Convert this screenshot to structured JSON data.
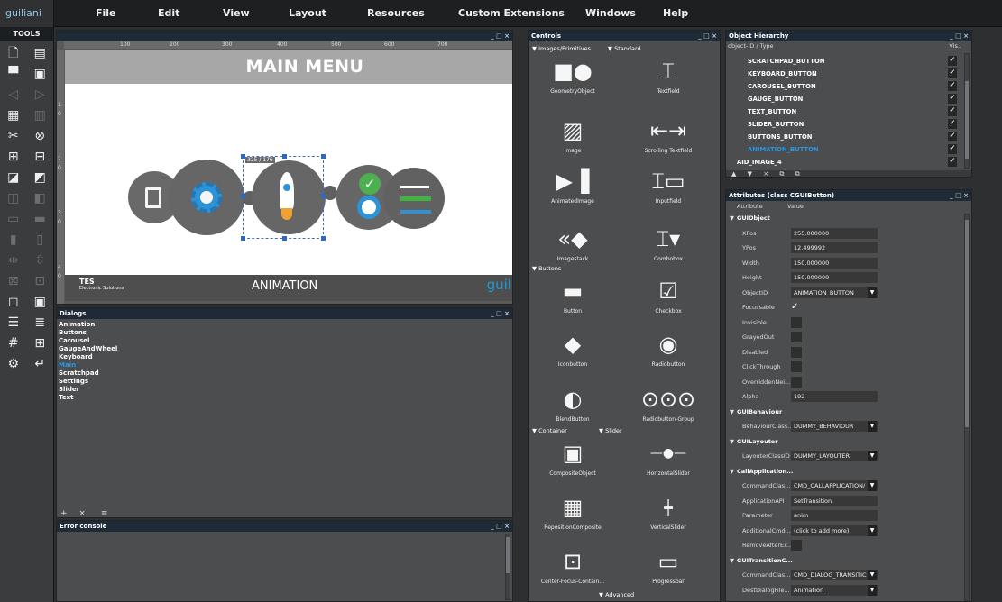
{
  "app": {
    "logo": "guiliani",
    "tools_title": "TOOLS"
  },
  "menu": [
    "File",
    "Edit",
    "View",
    "Layout",
    "Resources",
    "Custom Extensions",
    "Windows",
    "Help"
  ],
  "editor": {
    "window_controls": "_ □ ×",
    "ruler_top": [
      "100",
      "200",
      "300",
      "400",
      "500",
      "600",
      "700"
    ],
    "ruler_left": [
      "1",
      "0",
      "2",
      "0",
      "3",
      "0",
      "4",
      "0"
    ],
    "banner": "MAIN MENU",
    "footer_label": "ANIMATION",
    "brand": "guiliani",
    "tes": "TES",
    "tes_sub": "Electronic Solutions",
    "selection_label": "325 / 176"
  },
  "dialogs": {
    "title": "Dialogs",
    "items": [
      "Animation",
      "Buttons",
      "Carousel",
      "GaugeAndWheel",
      "Keyboard",
      "Main",
      "Scratchpad",
      "Settings",
      "Slider",
      "Text"
    ],
    "active": "Main",
    "controls": "_ □ ×",
    "footer_icons": [
      "+",
      "×",
      "≡"
    ]
  },
  "error_console": {
    "title": "Error console",
    "controls": "_ □ ×"
  },
  "controls_panel": {
    "title": "Controls",
    "window_controls": "_ □ ×",
    "section_images": "Images/Primitives",
    "section_standard": "Standard",
    "section_buttons": "Buttons",
    "section_container": "Container",
    "section_slider": "Slider",
    "section_advanced": "Advanced",
    "items": [
      {
        "label": "GeometryObject"
      },
      {
        "label": "Textfield"
      },
      {
        "label": "Image"
      },
      {
        "label": "Scrolling Textfield"
      },
      {
        "label": "AnimatedImage"
      },
      {
        "label": "Inputfield"
      },
      {
        "label": "Imagestack"
      },
      {
        "label": "Combobox"
      },
      {
        "label": "Button"
      },
      {
        "label": "Checkbox"
      },
      {
        "label": "Iconbutton"
      },
      {
        "label": "Radiobutton"
      },
      {
        "label": "BlendButton"
      },
      {
        "label": "Radiobutton-Group"
      },
      {
        "label": "CompositeObject"
      },
      {
        "label": "HorizontalSlider"
      },
      {
        "label": "RepositionComposite"
      },
      {
        "label": "VerticalSlider"
      },
      {
        "label": "Center-Focus-Contain..."
      },
      {
        "label": "Progressbar"
      }
    ]
  },
  "hierarchy": {
    "title": "Object Hierarchy",
    "window_controls": "_ □ ×",
    "columns": [
      "object-ID / Type",
      "Vis.."
    ],
    "rows": [
      "SCRATCHPAD_BUTTON",
      "KEYBOARD_BUTTON",
      "CAROUSEL_BUTTON",
      "GAUGE_BUTTON",
      "TEXT_BUTTON",
      "SLIDER_BUTTON",
      "BUTTONS_BUTTON",
      "ANIMATION_BUTTON",
      "AID_IMAGE_4"
    ],
    "selected": "ANIMATION_BUTTON",
    "check": "✓",
    "toolbar": [
      "▲",
      "▼",
      "×",
      "⧉",
      "⧉"
    ]
  },
  "attributes": {
    "title": "Attributes (class CGUIButton)",
    "window_controls": "_ □ ×",
    "col_attr": "Attribute",
    "col_value": "Value",
    "rows": [
      {
        "name": "GUIObject",
        "type": "category"
      },
      {
        "name": "XPos",
        "value": "255.000000"
      },
      {
        "name": "YPos",
        "value": "12.499992"
      },
      {
        "name": "Width",
        "value": "150.000000"
      },
      {
        "name": "Height",
        "value": "150.000000"
      },
      {
        "name": "ObjectID",
        "value": "ANIMATION_BUTTON",
        "drop": true
      },
      {
        "name": "Focussable",
        "type": "check"
      },
      {
        "name": "Invisible",
        "type": "box"
      },
      {
        "name": "GrayedOut",
        "type": "box"
      },
      {
        "name": "Disabled",
        "type": "box"
      },
      {
        "name": "ClickThrough",
        "type": "box"
      },
      {
        "name": "OverriddenNei...",
        "type": "box"
      },
      {
        "name": "Alpha",
        "value": "192"
      },
      {
        "name": "GUIBehaviour",
        "type": "category"
      },
      {
        "name": "BehaviourClass...",
        "value": "DUMMY_BEHAVIOUR",
        "drop": true
      },
      {
        "name": "GUILayouter",
        "type": "category"
      },
      {
        "name": "LayouterClassID",
        "value": "DUMMY_LAYOUTER",
        "drop": true
      },
      {
        "name": "CallApplication...",
        "type": "category"
      },
      {
        "name": "CommandClas...",
        "value": "CMD_CALLAPPLICATION/",
        "drop": true
      },
      {
        "name": "ApplicationAPI",
        "value": "SetTransition"
      },
      {
        "name": "Parameter",
        "value": "anim"
      },
      {
        "name": "AdditionalCmd...",
        "value": "(click to add more)",
        "drop": true
      },
      {
        "name": "RemoveAfterEx...",
        "type": "box"
      },
      {
        "name": "GUITransitionC...",
        "type": "category"
      },
      {
        "name": "CommandClas...",
        "value": "CMD_DIALOG_TRANSITIC",
        "drop": true
      },
      {
        "name": "DestDialogFile...",
        "value": "Animation",
        "drop": true
      }
    ]
  }
}
